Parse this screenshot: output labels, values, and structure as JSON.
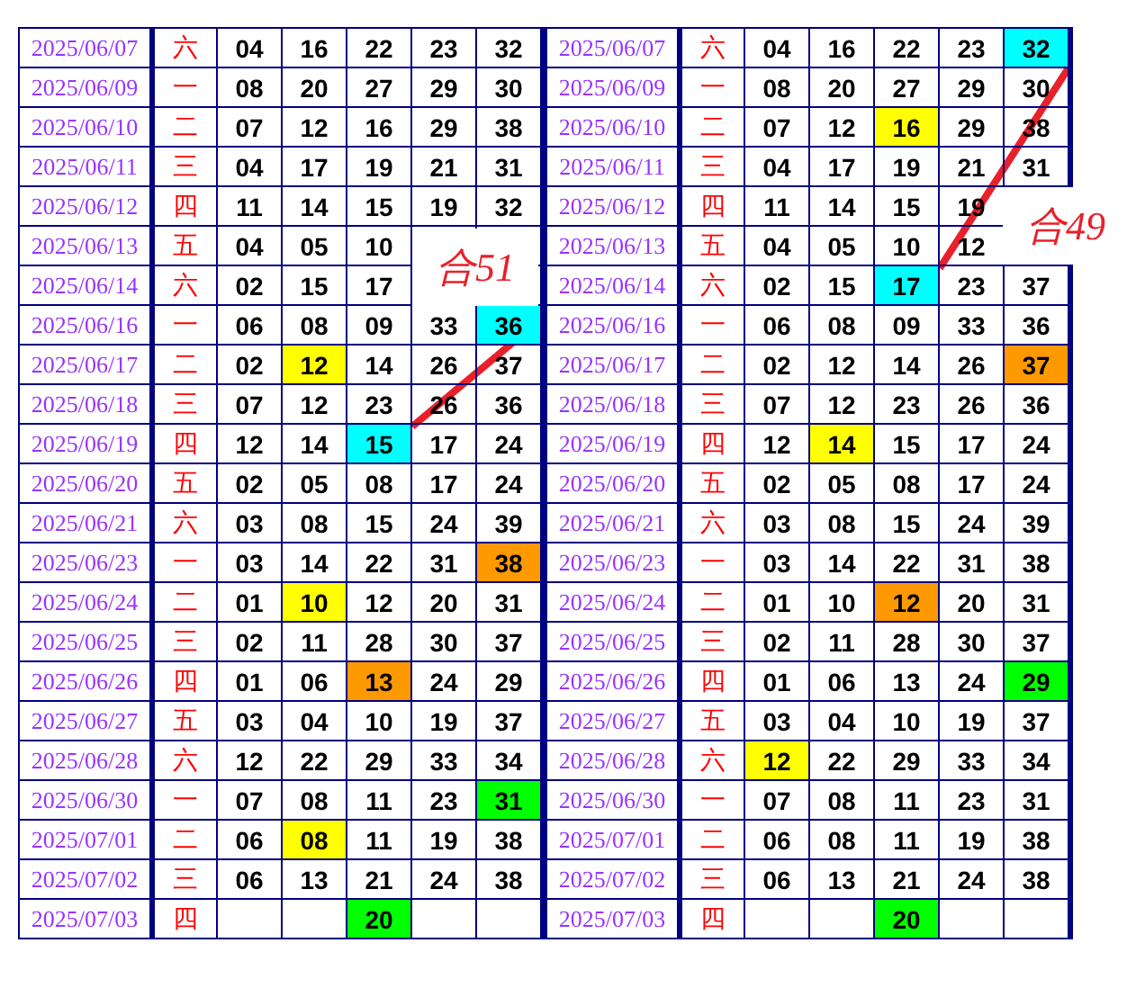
{
  "panels": [
    {
      "rows": [
        {
          "date": "2025/06/07",
          "weekday": "六",
          "nums": [
            "04",
            "16",
            "22",
            "23",
            "32"
          ]
        },
        {
          "date": "2025/06/09",
          "weekday": "一",
          "nums": [
            "08",
            "20",
            "27",
            "29",
            "30"
          ]
        },
        {
          "date": "2025/06/10",
          "weekday": "二",
          "nums": [
            "07",
            "12",
            "16",
            "29",
            "38"
          ]
        },
        {
          "date": "2025/06/11",
          "weekday": "三",
          "nums": [
            "04",
            "17",
            "19",
            "21",
            "31"
          ]
        },
        {
          "date": "2025/06/12",
          "weekday": "四",
          "nums": [
            "11",
            "14",
            "15",
            "19",
            "32"
          ]
        },
        {
          "date": "2025/06/13",
          "weekday": "五",
          "nums": [
            "04",
            "05",
            "10",
            {
              "kind": "empty"
            },
            {
              "kind": "empty"
            }
          ]
        },
        {
          "date": "2025/06/14",
          "weekday": "六",
          "nums": [
            "02",
            "15",
            "17",
            {
              "kind": "empty"
            },
            {
              "kind": "empty"
            }
          ]
        },
        {
          "date": "2025/06/16",
          "weekday": "一",
          "nums": [
            "06",
            "08",
            "09",
            "33",
            {
              "n": "36",
              "color": "#00ffff"
            }
          ]
        },
        {
          "date": "2025/06/17",
          "weekday": "二",
          "nums": [
            "02",
            {
              "n": "12",
              "color": "#ffff00"
            },
            "14",
            "26",
            "37"
          ]
        },
        {
          "date": "2025/06/18",
          "weekday": "三",
          "nums": [
            "07",
            "12",
            "23",
            "26",
            "36"
          ]
        },
        {
          "date": "2025/06/19",
          "weekday": "四",
          "nums": [
            "12",
            "14",
            {
              "n": "15",
              "color": "#00ffff"
            },
            "17",
            "24"
          ]
        },
        {
          "date": "2025/06/20",
          "weekday": "五",
          "nums": [
            "02",
            "05",
            "08",
            "17",
            "24"
          ]
        },
        {
          "date": "2025/06/21",
          "weekday": "六",
          "nums": [
            "03",
            "08",
            "15",
            "24",
            "39"
          ]
        },
        {
          "date": "2025/06/23",
          "weekday": "一",
          "nums": [
            "03",
            "14",
            "22",
            "31",
            {
              "n": "38",
              "color": "#ff9900"
            }
          ]
        },
        {
          "date": "2025/06/24",
          "weekday": "二",
          "nums": [
            "01",
            {
              "n": "10",
              "color": "#ffff00"
            },
            "12",
            "20",
            "31"
          ]
        },
        {
          "date": "2025/06/25",
          "weekday": "三",
          "nums": [
            "02",
            "11",
            "28",
            "30",
            "37"
          ]
        },
        {
          "date": "2025/06/26",
          "weekday": "四",
          "nums": [
            "01",
            "06",
            {
              "n": "13",
              "color": "#ff9900"
            },
            "24",
            "29"
          ]
        },
        {
          "date": "2025/06/27",
          "weekday": "五",
          "nums": [
            "03",
            "04",
            "10",
            "19",
            "37"
          ]
        },
        {
          "date": "2025/06/28",
          "weekday": "六",
          "nums": [
            "12",
            "22",
            "29",
            "33",
            "34"
          ]
        },
        {
          "date": "2025/06/30",
          "weekday": "一",
          "nums": [
            "07",
            "08",
            "11",
            "23",
            {
              "n": "31",
              "color": "#00ff00"
            }
          ]
        },
        {
          "date": "2025/07/01",
          "weekday": "二",
          "nums": [
            "06",
            {
              "n": "08",
              "color": "#ffff00"
            },
            "11",
            "19",
            "38"
          ]
        },
        {
          "date": "2025/07/02",
          "weekday": "三",
          "nums": [
            "06",
            "13",
            "21",
            "24",
            "38"
          ]
        },
        {
          "date": "2025/07/03",
          "weekday": "四",
          "nums": [
            {
              "kind": "empty"
            },
            {
              "kind": "empty"
            },
            {
              "n": "20",
              "color": "#00ff00"
            },
            {
              "kind": "empty"
            },
            {
              "kind": "empty"
            }
          ]
        }
      ]
    },
    {
      "rows": [
        {
          "date": "2025/06/07",
          "weekday": "六",
          "nums": [
            "04",
            "16",
            "22",
            "23",
            {
              "n": "32",
              "color": "#00ffff"
            }
          ]
        },
        {
          "date": "2025/06/09",
          "weekday": "一",
          "nums": [
            "08",
            "20",
            "27",
            "29",
            "30"
          ]
        },
        {
          "date": "2025/06/10",
          "weekday": "二",
          "nums": [
            "07",
            "12",
            {
              "n": "16",
              "color": "#ffff00"
            },
            "29",
            "38"
          ]
        },
        {
          "date": "2025/06/11",
          "weekday": "三",
          "nums": [
            "04",
            "17",
            "19",
            "21",
            "31"
          ]
        },
        {
          "date": "2025/06/12",
          "weekday": "四",
          "nums": [
            "11",
            "14",
            "15",
            "19",
            {
              "kind": "empty"
            }
          ]
        },
        {
          "date": "2025/06/13",
          "weekday": "五",
          "nums": [
            "04",
            "05",
            "10",
            "12",
            {
              "kind": "empty"
            }
          ]
        },
        {
          "date": "2025/06/14",
          "weekday": "六",
          "nums": [
            "02",
            "15",
            {
              "n": "17",
              "color": "#00ffff"
            },
            "23",
            "37"
          ]
        },
        {
          "date": "2025/06/16",
          "weekday": "一",
          "nums": [
            "06",
            "08",
            "09",
            "33",
            "36"
          ]
        },
        {
          "date": "2025/06/17",
          "weekday": "二",
          "nums": [
            "02",
            "12",
            "14",
            "26",
            {
              "n": "37",
              "color": "#ff9900"
            }
          ]
        },
        {
          "date": "2025/06/18",
          "weekday": "三",
          "nums": [
            "07",
            "12",
            "23",
            "26",
            "36"
          ]
        },
        {
          "date": "2025/06/19",
          "weekday": "四",
          "nums": [
            "12",
            {
              "n": "14",
              "color": "#ffff00"
            },
            "15",
            "17",
            "24"
          ]
        },
        {
          "date": "2025/06/20",
          "weekday": "五",
          "nums": [
            "02",
            "05",
            "08",
            "17",
            "24"
          ]
        },
        {
          "date": "2025/06/21",
          "weekday": "六",
          "nums": [
            "03",
            "08",
            "15",
            "24",
            "39"
          ]
        },
        {
          "date": "2025/06/23",
          "weekday": "一",
          "nums": [
            "03",
            "14",
            "22",
            "31",
            "38"
          ]
        },
        {
          "date": "2025/06/24",
          "weekday": "二",
          "nums": [
            "01",
            "10",
            {
              "n": "12",
              "color": "#ff9900"
            },
            "20",
            "31"
          ]
        },
        {
          "date": "2025/06/25",
          "weekday": "三",
          "nums": [
            "02",
            "11",
            "28",
            "30",
            "37"
          ]
        },
        {
          "date": "2025/06/26",
          "weekday": "四",
          "nums": [
            "01",
            "06",
            "13",
            "24",
            {
              "n": "29",
              "color": "#00ff00"
            }
          ]
        },
        {
          "date": "2025/06/27",
          "weekday": "五",
          "nums": [
            "03",
            "04",
            "10",
            "19",
            "37"
          ]
        },
        {
          "date": "2025/06/28",
          "weekday": "六",
          "nums": [
            {
              "n": "12",
              "color": "#ffff00"
            },
            "22",
            "29",
            "33",
            "34"
          ]
        },
        {
          "date": "2025/06/30",
          "weekday": "一",
          "nums": [
            "07",
            "08",
            "11",
            "23",
            "31"
          ]
        },
        {
          "date": "2025/07/01",
          "weekday": "二",
          "nums": [
            "06",
            "08",
            "11",
            "19",
            "38"
          ]
        },
        {
          "date": "2025/07/02",
          "weekday": "三",
          "nums": [
            "06",
            "13",
            "21",
            "24",
            "38"
          ]
        },
        {
          "date": "2025/07/03",
          "weekday": "四",
          "nums": [
            {
              "kind": "empty"
            },
            {
              "kind": "empty"
            },
            {
              "n": "20",
              "color": "#00ff00"
            },
            {
              "kind": "empty"
            },
            {
              "kind": "empty"
            }
          ]
        }
      ]
    }
  ],
  "annotations": [
    {
      "text": "合51"
    },
    {
      "text": "合49"
    }
  ]
}
